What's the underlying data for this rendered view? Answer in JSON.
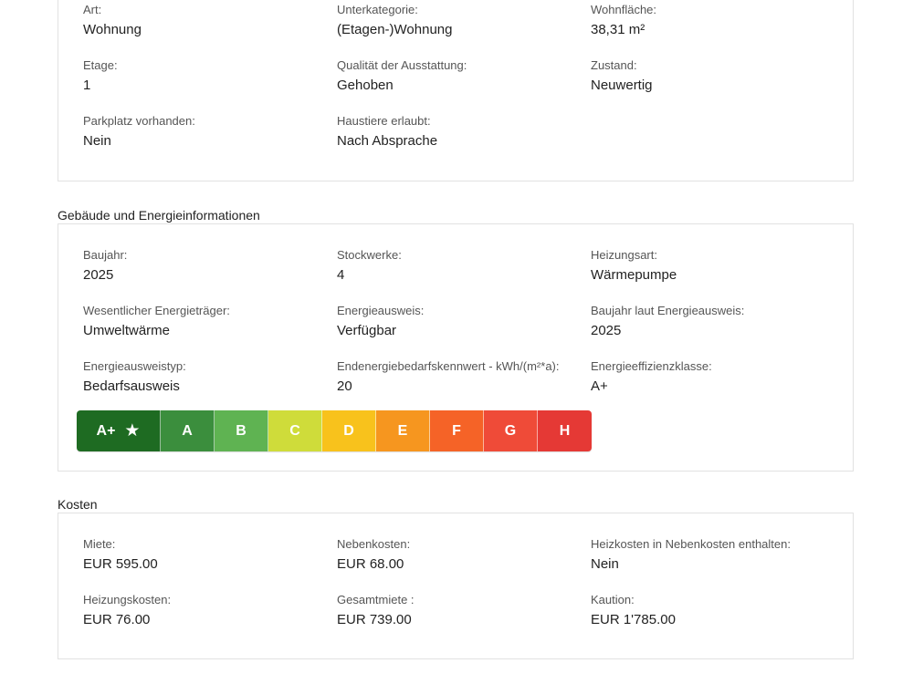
{
  "details": {
    "rows": [
      [
        {
          "label": "Art:",
          "value": "Wohnung"
        },
        {
          "label": "Unterkategorie:",
          "value": "(Etagen-)Wohnung"
        },
        {
          "label": "Wohnfläche:",
          "value": "38,31 m²"
        }
      ],
      [
        {
          "label": "Etage:",
          "value": "1"
        },
        {
          "label": "Qualität der Ausstattung:",
          "value": "Gehoben"
        },
        {
          "label": "Zustand:",
          "value": "Neuwertig"
        }
      ],
      [
        {
          "label": "Parkplatz vorhanden:",
          "value": "Nein"
        },
        {
          "label": "Haustiere erlaubt:",
          "value": "Nach Absprache"
        }
      ]
    ]
  },
  "building": {
    "title": "Gebäude und Energieinformationen",
    "rows": [
      [
        {
          "label": "Baujahr:",
          "value": "2025"
        },
        {
          "label": "Stockwerke:",
          "value": "4"
        },
        {
          "label": "Heizungsart:",
          "value": "Wärmepumpe"
        }
      ],
      [
        {
          "label": "Wesentlicher Energieträger:",
          "value": "Umweltwärme"
        },
        {
          "label": "Energieausweis:",
          "value": "Verfügbar"
        },
        {
          "label": "Baujahr laut Energieausweis:",
          "value": "2025"
        }
      ],
      [
        {
          "label": "Energieausweistyp:",
          "value": "Bedarfsausweis"
        },
        {
          "label": "Endenergiebedarfskennwert - kWh/(m²*a):",
          "value": "20"
        },
        {
          "label": "Energieeffizienzklasse:",
          "value": "A+"
        }
      ]
    ],
    "energy_scale": [
      {
        "label": "A+",
        "color": "#1e6b22",
        "icon": "star-icon"
      },
      {
        "label": "A",
        "color": "#3b8e3d"
      },
      {
        "label": "B",
        "color": "#5fb352"
      },
      {
        "label": "C",
        "color": "#cfdc3a"
      },
      {
        "label": "D",
        "color": "#f8c21c"
      },
      {
        "label": "E",
        "color": "#f6961f"
      },
      {
        "label": "F",
        "color": "#f56327"
      },
      {
        "label": "G",
        "color": "#ef4b38"
      },
      {
        "label": "H",
        "color": "#e53935"
      }
    ]
  },
  "costs": {
    "title": "Kosten",
    "rows": [
      [
        {
          "label": "Miete:",
          "value": "EUR 595.00"
        },
        {
          "label": "Nebenkosten:",
          "value": "EUR 68.00"
        },
        {
          "label": "Heizkosten in Nebenkosten enthalten:",
          "value": "Nein"
        }
      ],
      [
        {
          "label": "Heizungskosten:",
          "value": "EUR 76.00"
        },
        {
          "label": "Gesamtmiete :",
          "value": "EUR 739.00"
        },
        {
          "label": "Kaution:",
          "value": "EUR 1'785.00"
        }
      ]
    ]
  }
}
